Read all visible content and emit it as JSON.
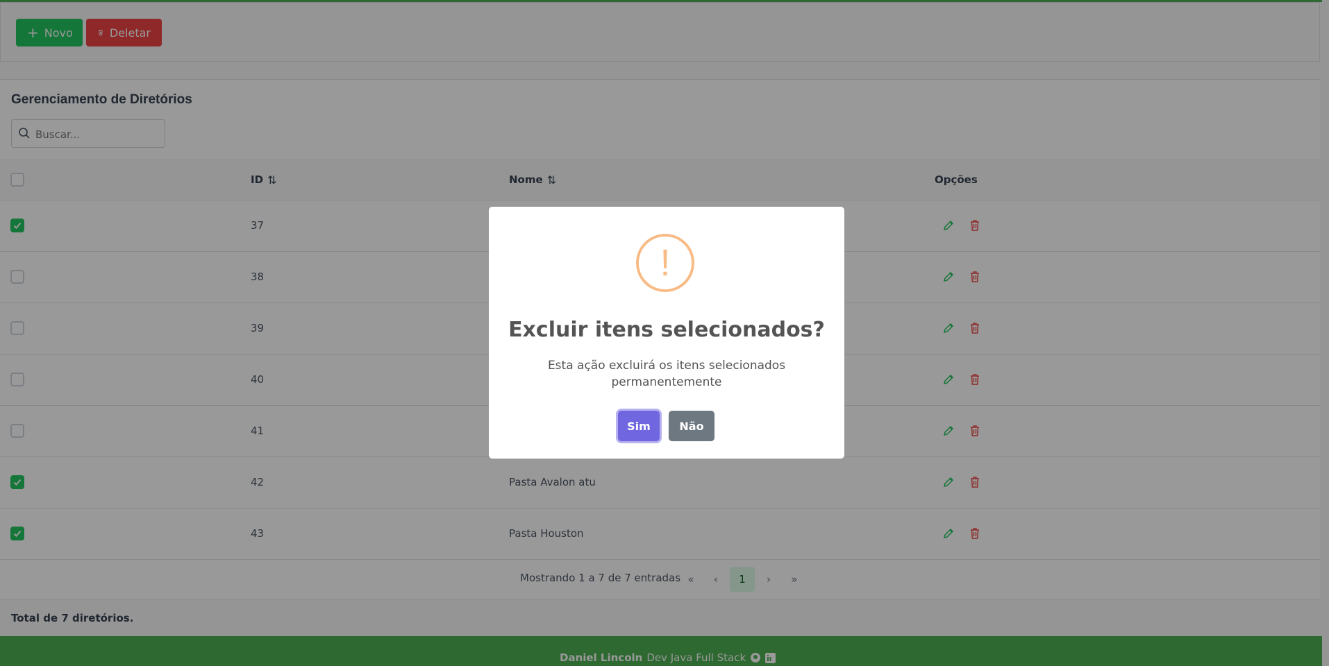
{
  "toolbar": {
    "new_label": "Novo",
    "delete_label": "Deletar"
  },
  "card": {
    "title": "Gerenciamento de Diretórios",
    "search_placeholder": "Buscar..."
  },
  "table": {
    "headers": {
      "id": "ID",
      "name": "Nome",
      "options": "Opções"
    },
    "rows": [
      {
        "id": "37",
        "name": "",
        "checked": true
      },
      {
        "id": "38",
        "name": "",
        "checked": false
      },
      {
        "id": "39",
        "name": "",
        "checked": false
      },
      {
        "id": "40",
        "name": "",
        "checked": false
      },
      {
        "id": "41",
        "name": "",
        "checked": false
      },
      {
        "id": "42",
        "name": "Pasta Avalon atu",
        "checked": true
      },
      {
        "id": "43",
        "name": "Pasta Houston",
        "checked": true
      }
    ]
  },
  "paginator": {
    "report": "Mostrando 1 a 7 de 7 entradas",
    "current_page": "1",
    "first": "«",
    "prev": "‹",
    "next": "›",
    "last": "»"
  },
  "summary": {
    "total": "Total de 7 diretórios."
  },
  "footer": {
    "author": "Daniel Lincoln",
    "role": "Dev Java Full Stack"
  },
  "dialog": {
    "title": "Excluir itens selecionados?",
    "text": "Esta ação excluirá os itens selecionados permanentemente",
    "confirm_label": "Sim",
    "cancel_label": "Não",
    "icon": "!"
  },
  "colors": {
    "success": "#22c55e",
    "danger": "#ef4444",
    "confirm": "#7066e0",
    "warning": "#f8bb86",
    "footer": "#4caf50"
  }
}
